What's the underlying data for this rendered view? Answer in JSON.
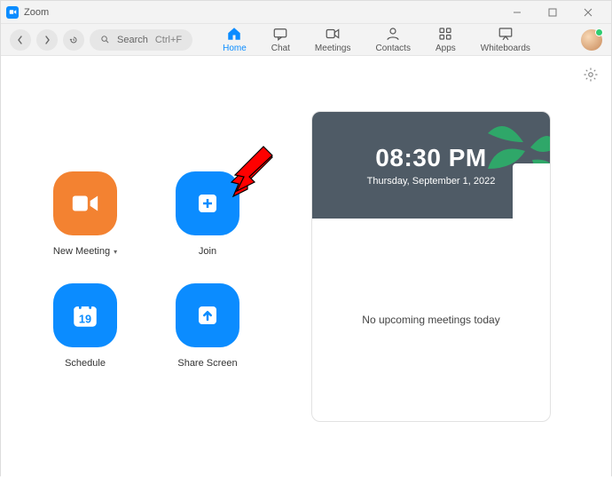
{
  "window": {
    "title": "Zoom"
  },
  "toolbar": {
    "search_label": "Search",
    "shortcut": "Ctrl+F"
  },
  "nav": {
    "home": "Home",
    "chat": "Chat",
    "meetings": "Meetings",
    "contacts": "Contacts",
    "apps": "Apps",
    "whiteboards": "Whiteboards"
  },
  "tiles": {
    "new_meeting": "New Meeting",
    "join": "Join",
    "schedule": "Schedule",
    "share_screen": "Share Screen",
    "schedule_day": "19"
  },
  "calendar": {
    "time": "08:30 PM",
    "date": "Thursday, September 1, 2022",
    "empty": "No upcoming meetings today"
  },
  "colors": {
    "accent_blue": "#0b8cff",
    "accent_orange": "#f38231",
    "arrow": "#ff0000"
  }
}
